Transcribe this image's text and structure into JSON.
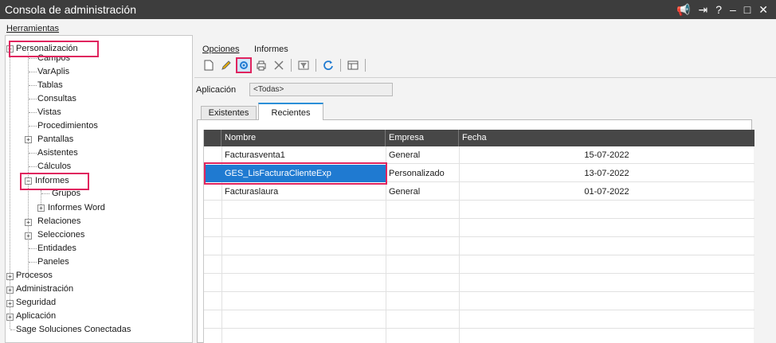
{
  "window": {
    "title": "Consola de administración",
    "controls": [
      "📢",
      "⇥",
      "?",
      "–",
      "□",
      "✕"
    ]
  },
  "menubar": {
    "herramientas": "Herramientas"
  },
  "tree": {
    "personalizacion": "Personalización",
    "campos": "Campos",
    "varaplis": "VarAplis",
    "tablas": "Tablas",
    "consultas": "Consultas",
    "vistas": "Vistas",
    "procedimientos": "Procedimientos",
    "pantallas": "Pantallas",
    "asistentes": "Asistentes",
    "calculos": "Cálculos",
    "informes": "Informes",
    "grupos": "Grupos",
    "informes_word": "Informes Word",
    "relaciones": "Relaciones",
    "selecciones": "Selecciones",
    "entidades": "Entidades",
    "paneles": "Paneles",
    "procesos": "Procesos",
    "administracion": "Administración",
    "seguridad": "Seguridad",
    "aplicacion": "Aplicación",
    "sage": "Sage Soluciones Conectadas"
  },
  "right": {
    "menu_opciones": "Opciones",
    "menu_informes": "Informes",
    "app_label": "Aplicación",
    "app_value": "<Todas>",
    "tab_existentes": "Existentes",
    "tab_recientes": "Recientes"
  },
  "grid": {
    "headers": {
      "nombre": "Nombre",
      "empresa": "Empresa",
      "fecha": "Fecha"
    },
    "rows": [
      {
        "nombre": "Facturasventa1",
        "empresa": "General",
        "fecha": "15-07-2022"
      },
      {
        "nombre": "GES_LisFacturaClienteExp",
        "empresa": "Personalizado",
        "fecha": "13-07-2022"
      },
      {
        "nombre": "Facturaslaura",
        "empresa": "General",
        "fecha": "01-07-2022"
      }
    ]
  },
  "colors": {
    "titlebar": "#3d3d3d",
    "highlight": "#e0245e",
    "selection": "#1f7ad1",
    "tab_accent": "#2b8fd8"
  }
}
